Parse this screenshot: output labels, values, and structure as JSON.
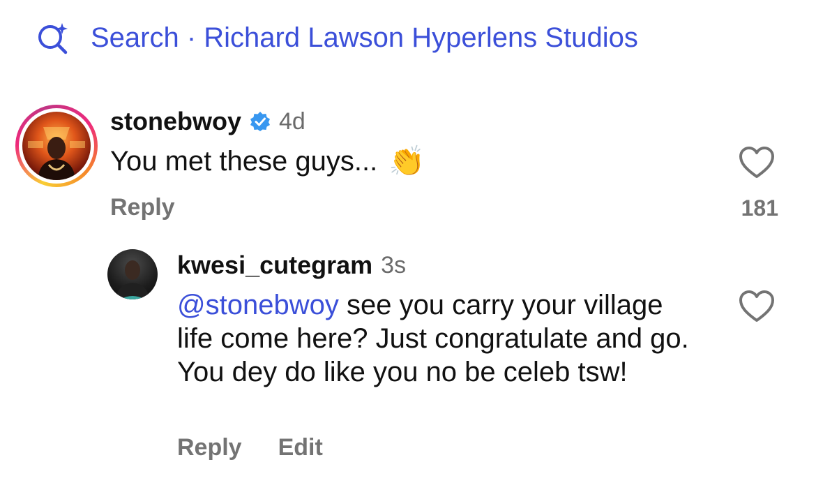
{
  "search": {
    "label": "Search · Richard Lawson Hyperlens Studios",
    "icon": "sparkle-search-icon",
    "color": "#3b4fd9"
  },
  "comments": [
    {
      "username": "stonebwoy",
      "verified": true,
      "time": "4d",
      "text": "You met these guys...",
      "emoji": "👏",
      "reply_label": "Reply",
      "likes": "181"
    },
    {
      "username": "kwesi_cutegram",
      "time": "3s",
      "mention": "@stonebwoy",
      "text": " see you carry your village life come here? Just congratulate and go. You dey do like you no be celeb tsw!",
      "reply_label": "Reply",
      "edit_label": "Edit"
    }
  ]
}
